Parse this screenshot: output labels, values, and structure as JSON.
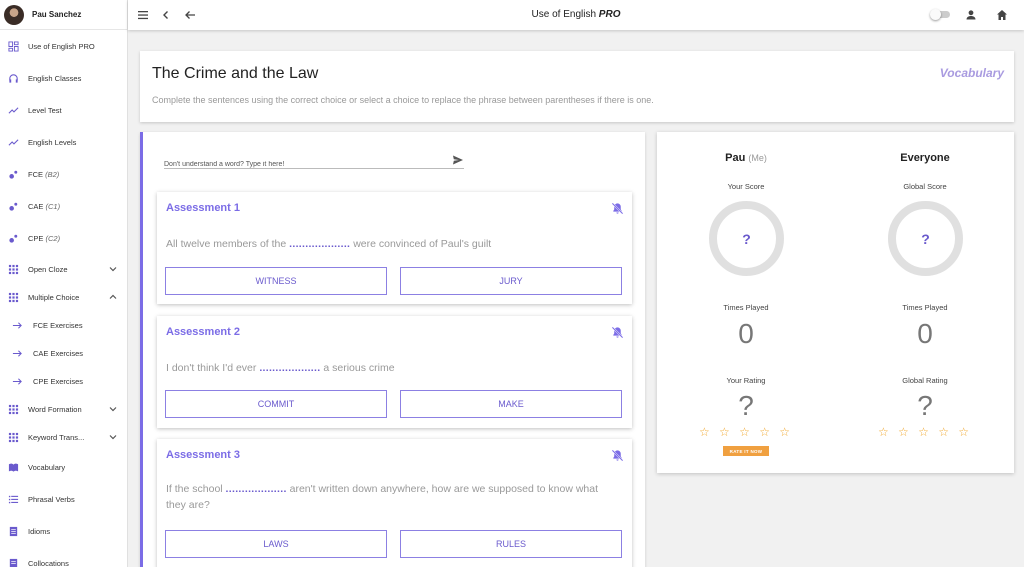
{
  "user": {
    "name": "Pau Sanchez"
  },
  "topbar": {
    "title_main": "Use of English",
    "title_suffix": "PRO"
  },
  "sidebar": {
    "items": [
      {
        "label": "Use of English PRO",
        "icon": "dashboard-icon"
      },
      {
        "label": "English Classes",
        "icon": "headphones-icon"
      },
      {
        "label": "Level Test",
        "icon": "trending-icon"
      },
      {
        "label": "English Levels",
        "icon": "trending-icon"
      },
      {
        "label": "FCE",
        "sublabel": "(B2)",
        "icon": "bubble-icon"
      },
      {
        "label": "CAE",
        "sublabel": "(C1)",
        "icon": "bubble-icon"
      },
      {
        "label": "CPE",
        "sublabel": "(C2)",
        "icon": "bubble-icon"
      },
      {
        "label": "Open Cloze",
        "icon": "apps-icon",
        "expand": "chevron-down-icon"
      },
      {
        "label": "Multiple Choice",
        "icon": "apps-icon",
        "expand": "chevron-up-icon"
      },
      {
        "label": "FCE Exercises",
        "icon": "arrow-right-icon"
      },
      {
        "label": "CAE Exercises",
        "icon": "arrow-right-icon"
      },
      {
        "label": "CPE Exercises",
        "icon": "arrow-right-icon"
      },
      {
        "label": "Word Formation",
        "icon": "apps-icon",
        "expand": "chevron-down-icon"
      },
      {
        "label": "Keyword Trans...",
        "icon": "apps-icon",
        "expand": "chevron-down-icon"
      },
      {
        "label": "Vocabulary",
        "icon": "book-icon"
      },
      {
        "label": "Phrasal Verbs",
        "icon": "list-icon"
      },
      {
        "label": "Idioms",
        "icon": "notes-icon"
      },
      {
        "label": "Collocations",
        "icon": "notes-icon"
      }
    ]
  },
  "header": {
    "title": "The Crime and the Law",
    "category": "Vocabulary",
    "instructions": "Complete the sentences using the correct choice or select a choice to replace the phrase between parentheses if there is one."
  },
  "word_help": {
    "placeholder": "Don't understand a word? Type it here!"
  },
  "assessments": [
    {
      "title": "Assessment 1",
      "before": "All twelve members of the ",
      "blank": "...................",
      "after": " were convinced of Paul's guilt",
      "choices": [
        "WITNESS",
        "JURY"
      ]
    },
    {
      "title": "Assessment 2",
      "before": "I don't think I'd ever ",
      "blank": "...................",
      "after": " a serious crime",
      "choices": [
        "COMMIT",
        "MAKE"
      ]
    },
    {
      "title": "Assessment 3",
      "before": "If the school ",
      "blank": "...................",
      "after": " aren't written down anywhere, how are we supposed to know what they are?",
      "choices": [
        "LAWS",
        "RULES"
      ]
    }
  ],
  "stats": {
    "me": {
      "name": "Pau",
      "tag": "(Me)",
      "score_label": "Your Score",
      "score": "?",
      "played_label": "Times Played",
      "played": "0",
      "rating_label": "Your Rating",
      "rating": "?",
      "stars": "☆ ☆ ☆ ☆ ☆",
      "rate_button": "RATE IT NOW"
    },
    "everyone": {
      "name": "Everyone",
      "score_label": "Global Score",
      "score": "?",
      "played_label": "Times Played",
      "played": "0",
      "rating_label": "Global Rating",
      "rating": "?",
      "stars": "☆ ☆ ☆ ☆ ☆"
    }
  },
  "colors": {
    "accent": "#7b6ce6",
    "star": "#f0a830",
    "rate_button": "#f0a040"
  }
}
